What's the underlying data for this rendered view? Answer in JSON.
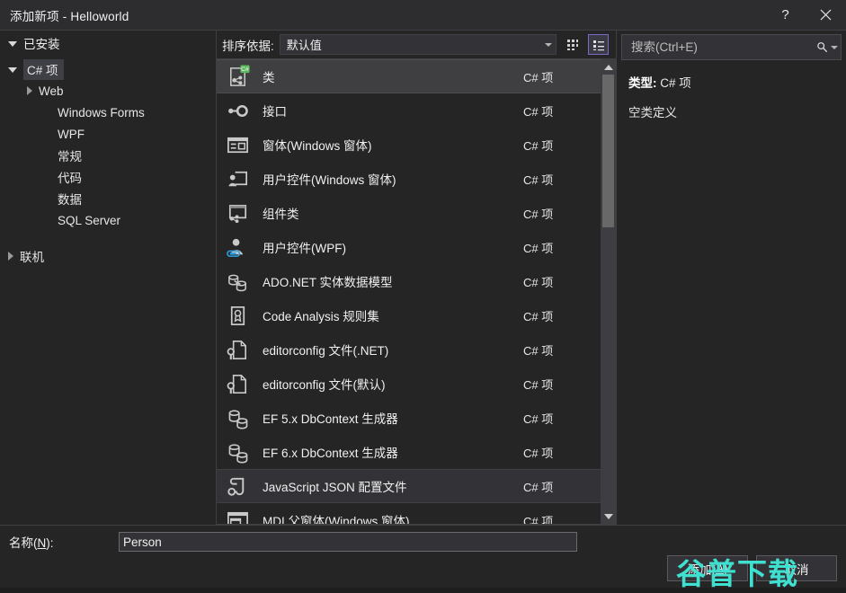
{
  "window": {
    "title": "添加新项 - Helloworld",
    "help_button": "?",
    "close_button": "×"
  },
  "left_panel": {
    "installed_header": "已安装",
    "tree": [
      {
        "label": "C# 项",
        "level": 1,
        "expanded": true,
        "selected": true,
        "has_children": true
      },
      {
        "label": "Web",
        "level": 2,
        "expanded": false,
        "selected": false,
        "has_children": true
      },
      {
        "label": "Windows Forms",
        "level": 3,
        "expanded": false,
        "selected": false,
        "has_children": false
      },
      {
        "label": "WPF",
        "level": 3,
        "expanded": false,
        "selected": false,
        "has_children": false
      },
      {
        "label": "常规",
        "level": 3,
        "expanded": false,
        "selected": false,
        "has_children": false
      },
      {
        "label": "代码",
        "level": 3,
        "expanded": false,
        "selected": false,
        "has_children": false
      },
      {
        "label": "数据",
        "level": 3,
        "expanded": false,
        "selected": false,
        "has_children": false
      },
      {
        "label": "SQL Server",
        "level": 3,
        "expanded": false,
        "selected": false,
        "has_children": false
      },
      {
        "label": "联机",
        "level": 1,
        "expanded": false,
        "selected": false,
        "has_children": true
      }
    ]
  },
  "center_panel": {
    "sort_label": "排序依据:",
    "sort_value": "默认值",
    "view_grid_title": "网格视图",
    "view_list_title": "列表视图",
    "active_view": "list",
    "items": [
      {
        "name": "类",
        "kind": "C# 项",
        "icon": "class-icon",
        "state": "selected"
      },
      {
        "name": "接口",
        "kind": "C# 项",
        "icon": "interface-icon",
        "state": "normal"
      },
      {
        "name": "窗体(Windows 窗体)",
        "kind": "C# 项",
        "icon": "form-icon",
        "state": "normal"
      },
      {
        "name": "用户控件(Windows 窗体)",
        "kind": "C# 项",
        "icon": "user-control-icon",
        "state": "normal"
      },
      {
        "name": "组件类",
        "kind": "C# 项",
        "icon": "component-class-icon",
        "state": "normal"
      },
      {
        "name": "用户控件(WPF)",
        "kind": "C# 项",
        "icon": "wpf-user-control-icon",
        "state": "normal"
      },
      {
        "name": "ADO.NET 实体数据模型",
        "kind": "C# 项",
        "icon": "ado-entity-model-icon",
        "state": "normal"
      },
      {
        "name": "Code Analysis 规则集",
        "kind": "C# 项",
        "icon": "ruleset-icon",
        "state": "normal"
      },
      {
        "name": "editorconfig 文件(.NET)",
        "kind": "C# 项",
        "icon": "editorconfig-icon",
        "state": "normal"
      },
      {
        "name": "editorconfig 文件(默认)",
        "kind": "C# 项",
        "icon": "editorconfig-icon",
        "state": "normal"
      },
      {
        "name": "EF 5.x DbContext 生成器",
        "kind": "C# 项",
        "icon": "ef-dbcontext-icon",
        "state": "normal"
      },
      {
        "name": "EF 6.x DbContext 生成器",
        "kind": "C# 项",
        "icon": "ef-dbcontext-icon",
        "state": "normal"
      },
      {
        "name": "JavaScript JSON 配置文件",
        "kind": "C# 项",
        "icon": "json-config-icon",
        "state": "hovered"
      },
      {
        "name": "MDI 父窗体(Windows 窗体)",
        "kind": "C# 项",
        "icon": "mdi-parent-form-icon",
        "state": "normal"
      }
    ]
  },
  "right_panel": {
    "search_placeholder": "搜索(Ctrl+E)",
    "search_value": "",
    "type_label": "类型:",
    "type_value": "C# 项",
    "description": "空类定义"
  },
  "footer": {
    "name_label_prefix": "名称(",
    "name_label_key": "N",
    "name_label_suffix": "):",
    "name_value": "Person",
    "add_button_prefix": "添加(",
    "add_button_key": "A",
    "add_button_suffix": ")",
    "cancel_button": "取消"
  },
  "overlay": {
    "watermark_text": "谷普下载",
    "watermark_color": "#3fe0d0",
    "annotation_color": "#e62222"
  }
}
